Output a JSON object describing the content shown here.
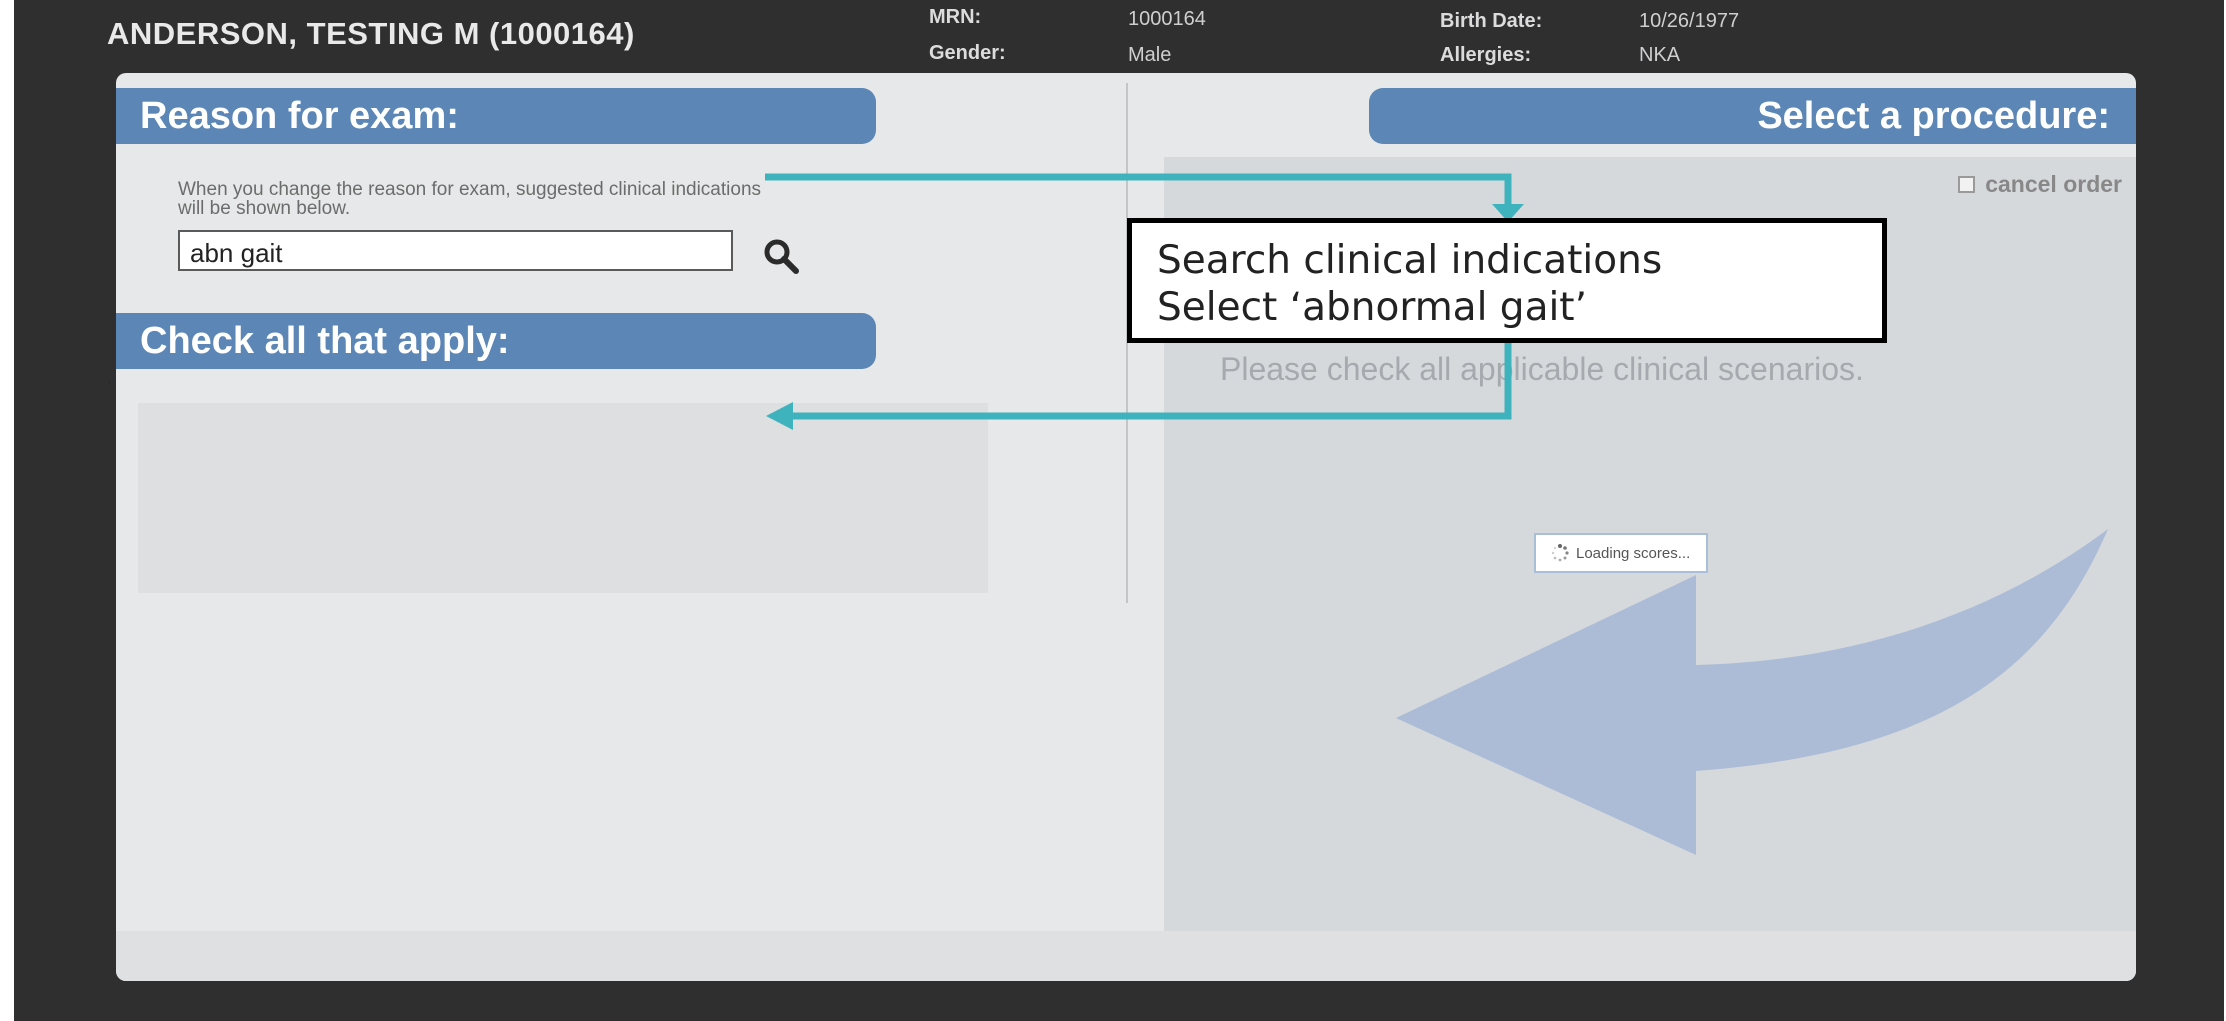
{
  "header": {
    "patient_name": "ANDERSON, TESTING M (1000164)",
    "mrn_label": "MRN:",
    "mrn_value": "1000164",
    "gender_label": "Gender:",
    "gender_value": "Male",
    "birth_date_label": "Birth Date:",
    "birth_date_value": "10/26/1977",
    "allergies_label": "Allergies:",
    "allergies_value": "NKA"
  },
  "reason_section": {
    "title": "Reason for exam:",
    "hint_line1": "When you change the reason for exam, suggested clinical indications",
    "hint_line2": "will be shown below.",
    "input_value": "abn gait",
    "search_icon": "magnifier-icon"
  },
  "check_section": {
    "title": "Check all that apply:"
  },
  "procedure_section": {
    "title": "Select a procedure:",
    "cancel_order_label": "cancel order",
    "cancel_order_checked": false,
    "scenario_message": "Please check all applicable clinical scenarios.",
    "loading_text": "Loading scores...",
    "arrow_icon": "curved-arrow-left-icon"
  },
  "annotation": {
    "line1": "Search clinical indications",
    "line2": "Select ‘abnormal gait’",
    "color": "#3fb3bd"
  },
  "colors": {
    "frame_background": "#2f2f30",
    "section_tab": "#5b86b6",
    "panel_background": "#e7e8e9",
    "arrow_overlay": "#8aa4d3"
  }
}
